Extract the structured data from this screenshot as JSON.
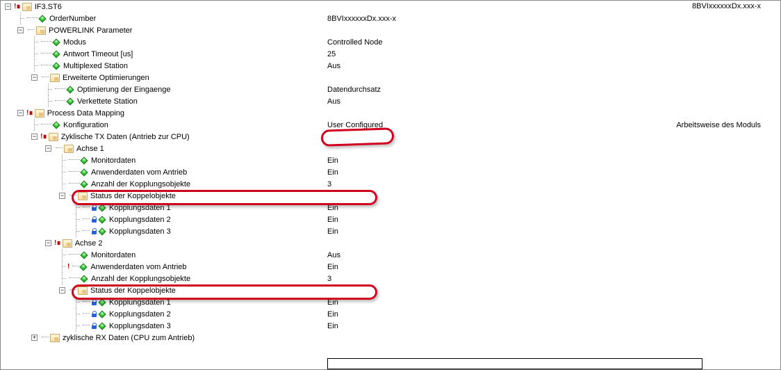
{
  "header": {
    "right_value": "8BVIxxxxxxDx.xxx-x"
  },
  "root": {
    "name": "IF3.ST6",
    "ordernumber": {
      "label": "OrderNumber",
      "value": "8BVIxxxxxxDx.xxx-x"
    },
    "powerlink": {
      "label": "POWERLINK Parameter",
      "modus": {
        "label": "Modus",
        "value": "Controlled Node"
      },
      "timeout": {
        "label": "Antwort Timeout [us]",
        "value": "25"
      },
      "mux": {
        "label": "Multiplexed Station",
        "value": "Aus"
      },
      "opt": {
        "label": "Erweiterte Optimierungen",
        "optin": {
          "label": "Optimierung der Eingaenge",
          "value": "Datendurchsatz"
        },
        "chain": {
          "label": "Verkettete Station",
          "value": "Aus"
        }
      }
    },
    "pdm": {
      "label": "Process Data Mapping",
      "config": {
        "label": "Konfiguration",
        "value": "User Configured",
        "desc": "Arbeitsweise des Moduls"
      },
      "tx": {
        "label": "Zyklische TX Daten (Antrieb zur CPU)",
        "axis1": {
          "label": "Achse 1",
          "mon": {
            "label": "Monitordaten",
            "value": "Ein"
          },
          "user": {
            "label": "Anwenderdaten vom Antrieb",
            "value": "Ein"
          },
          "cnt": {
            "label": "Anzahl der Kopplungsobjekte",
            "value": "3"
          },
          "stat": {
            "label": "Status der Koppelobjekte",
            "k1": {
              "label": "Kopplungsdaten 1",
              "value": "Ein"
            },
            "k2": {
              "label": "Kopplungsdaten 2",
              "value": "Ein"
            },
            "k3": {
              "label": "Kopplungsdaten 3",
              "value": "Ein"
            }
          }
        },
        "axis2": {
          "label": "Achse 2",
          "mon": {
            "label": "Monitordaten",
            "value": "Aus"
          },
          "user": {
            "label": "Anwenderdaten vom Antrieb",
            "value": "Ein"
          },
          "cnt": {
            "label": "Anzahl der Kopplungsobjekte",
            "value": "3"
          },
          "stat": {
            "label": "Status der Koppelobjekte",
            "k1": {
              "label": "Kopplungsdaten 1",
              "value": "Ein"
            },
            "k2": {
              "label": "Kopplungsdaten 2",
              "value": "Ein"
            },
            "k3": {
              "label": "Kopplungsdaten 3",
              "value": "Ein"
            }
          }
        }
      },
      "rx": {
        "label": "zyklische RX Daten (CPU zum Antrieb)"
      }
    }
  }
}
